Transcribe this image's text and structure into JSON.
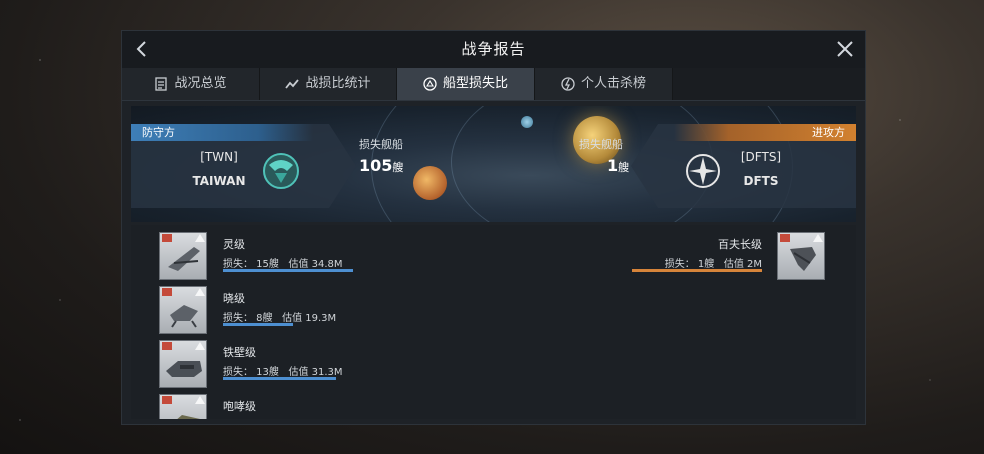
{
  "window": {
    "title": "战争报告"
  },
  "tabs": [
    {
      "label": "战况总览",
      "icon": "list-icon"
    },
    {
      "label": "战损比统计",
      "icon": "trend-icon"
    },
    {
      "label": "船型损失比",
      "icon": "ship-type-icon",
      "active": true
    },
    {
      "label": "个人击杀榜",
      "icon": "kill-icon"
    }
  ],
  "defender": {
    "tag": "防守方",
    "code": "[TWN]",
    "name": "TAIWAN",
    "loss_label": "损失舰船",
    "loss_value": "105",
    "loss_unit": "艘"
  },
  "attacker": {
    "tag": "进攻方",
    "code": "[DFTS]",
    "name": "DFTS",
    "loss_label": "损失舰船",
    "loss_value": "1",
    "loss_unit": "艘"
  },
  "defender_ships": [
    {
      "name": "灵级",
      "loss_text": "损失： 15艘",
      "value_text": "估值 34.8M"
    },
    {
      "name": "晓级",
      "loss_text": "损失： 8艘",
      "value_text": "估值 19.3M"
    },
    {
      "name": "铁壁级",
      "loss_text": "损失： 13艘",
      "value_text": "估值 31.3M"
    },
    {
      "name": "咆哮级",
      "loss_text": "",
      "value_text": ""
    }
  ],
  "attacker_ships": [
    {
      "name": "百夫长级",
      "loss_text": "损失： 1艘",
      "value_text": "估值 2M"
    }
  ],
  "colors": {
    "defender_bar": "#4d8fd1",
    "attacker_bar": "#d6843a"
  }
}
